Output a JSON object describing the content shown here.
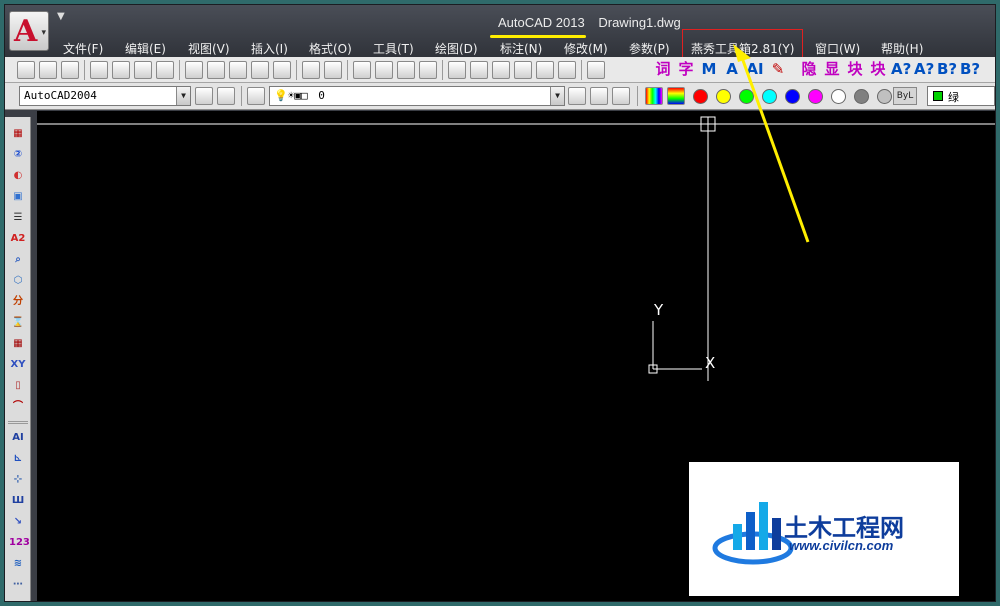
{
  "window": {
    "app_name": "AutoCAD 2013",
    "file_name": "Drawing1.dwg",
    "accent_yellow": "#ffee00",
    "highlight_red": "#e02020"
  },
  "menu": [
    {
      "label": "文件(F)"
    },
    {
      "label": "编辑(E)"
    },
    {
      "label": "视图(V)"
    },
    {
      "label": "插入(I)"
    },
    {
      "label": "格式(O)"
    },
    {
      "label": "工具(T)"
    },
    {
      "label": "绘图(D)"
    },
    {
      "label": "标注(N)"
    },
    {
      "label": "修改(M)"
    },
    {
      "label": "参数(P)"
    },
    {
      "label": "燕秀工具箱2.81(Y)"
    },
    {
      "label": "窗口(W)"
    },
    {
      "label": "帮助(H)"
    }
  ],
  "toolbar1": {
    "icons": [
      "new-icon",
      "open-icon",
      "save-icon",
      "print-icon",
      "print-preview-icon",
      "plot-icon",
      "publish-icon",
      "cut-icon",
      "copy-icon",
      "paste-icon",
      "match-properties-icon",
      "block-editor-icon",
      "undo-icon",
      "redo-icon",
      "pan-icon",
      "zoom-realtime-icon",
      "zoom-window-icon",
      "zoom-previous-icon",
      "properties-icon",
      "design-center-icon",
      "tool-palettes-icon",
      "sheet-set-icon",
      "markup-icon",
      "calculator-icon",
      "help-icon"
    ],
    "custom_glyphs": [
      {
        "text": "词",
        "color": "#c000c0"
      },
      {
        "text": "字",
        "color": "#c000c0"
      },
      {
        "text": "M",
        "color": "#0050c0"
      },
      {
        "text": "A",
        "color": "#0050c0"
      },
      {
        "text": "AI",
        "color": "#0050c0"
      },
      {
        "text": "✎",
        "color": "#c00000"
      },
      {
        "text": "隐",
        "color": "#c000c0"
      },
      {
        "text": "显",
        "color": "#c000c0"
      },
      {
        "text": "块",
        "color": "#c000c0"
      },
      {
        "text": "块",
        "color": "#c000c0"
      },
      {
        "text": "A?",
        "color": "#0050c0"
      },
      {
        "text": "A?",
        "color": "#0050c0"
      },
      {
        "text": "B?",
        "color": "#0050c0"
      },
      {
        "text": "B?",
        "color": "#0050c0"
      }
    ]
  },
  "toolbar2": {
    "workspace_value": "AutoCAD2004",
    "layer_value": "0",
    "color_swatches": [
      "#ff0000",
      "#ffff00",
      "#00ff00",
      "#00ffff",
      "#0000ff",
      "#ff00ff",
      "#ffffff",
      "#808080",
      "#c0c0c0"
    ],
    "bylayer_label": "ByL",
    "current_color_label": "绿",
    "current_color": "#00d000"
  },
  "left_palette": {
    "icons": [
      "table-icon",
      "measure-icon",
      "layer-icon",
      "align-icon",
      "list-icon",
      "text-a2-icon",
      "search-icon",
      "3d-box-icon",
      "layer-split-icon",
      "hourglass-icon",
      "grid-icon",
      "xy-icon",
      "mirror-icon",
      "fillet-icon",
      "text-ai-icon",
      "dimension-icon",
      "coordinates-icon",
      "beam-icon",
      "arrow-icon",
      "numbering-icon",
      "level-icon",
      "more-icon"
    ]
  },
  "canvas": {
    "background": "#000000",
    "ucs_y_label": "Y",
    "ucs_x_label": "X"
  },
  "watermark": {
    "title": "土木工程网",
    "url": "www.civilcn.com"
  }
}
